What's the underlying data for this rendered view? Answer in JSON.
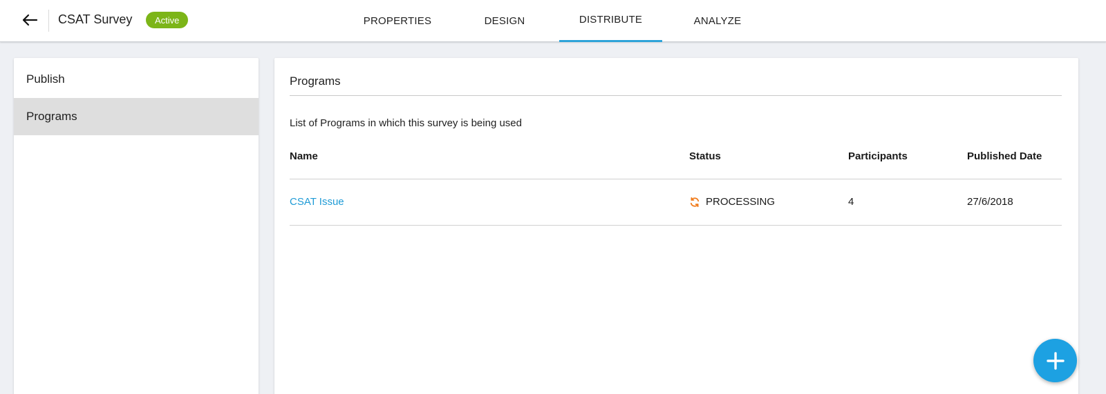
{
  "header": {
    "survey_title": "CSAT Survey",
    "status_badge": "Active",
    "tabs": [
      {
        "label": "PROPERTIES",
        "active": false
      },
      {
        "label": "DESIGN",
        "active": false
      },
      {
        "label": "DISTRIBUTE",
        "active": true
      },
      {
        "label": "ANALYZE",
        "active": false
      }
    ]
  },
  "sidebar": {
    "items": [
      {
        "label": "Publish",
        "selected": false
      },
      {
        "label": "Programs",
        "selected": true
      }
    ]
  },
  "main": {
    "title": "Programs",
    "description": "List of Programs in which this survey is being used",
    "columns": [
      "Name",
      "Status",
      "Participants",
      "Published Date"
    ],
    "rows": [
      {
        "name": "CSAT Issue",
        "status": "PROCESSING",
        "participants": "4",
        "published_date": "27/6/2018"
      }
    ]
  },
  "colors": {
    "accent": "#1da1e2",
    "tab_underline": "#2ea3d9",
    "badge_active": "#7cb518",
    "link": "#1f9bd6",
    "processing_icon": "#f07a1a"
  },
  "icons": {
    "back": "arrow-left-icon",
    "status": "refresh-icon",
    "fab": "plus-icon"
  }
}
